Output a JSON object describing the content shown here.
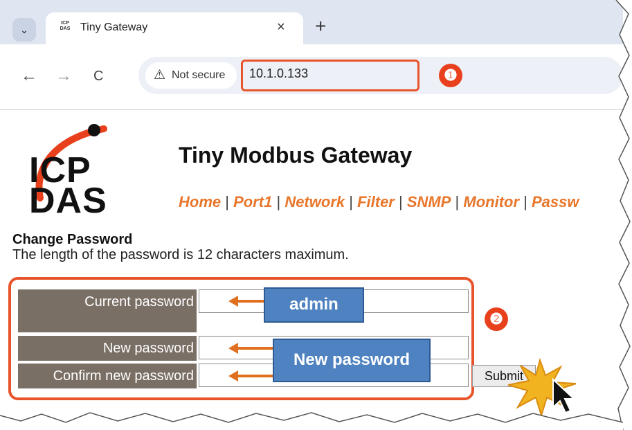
{
  "browser": {
    "tab_dropdown_icon": "chevron-down-icon",
    "tab_title": "Tiny Gateway",
    "tab_favicon_text": "ICP DAS",
    "tab_close": "×",
    "new_tab": "+",
    "back": "←",
    "forward": "→",
    "reload": "C",
    "security_warning_icon": "⚠",
    "security_label": "Not secure",
    "url": "10.1.0.133"
  },
  "annotations": {
    "step1": "❶",
    "step2": "❷",
    "callout_current": "admin",
    "callout_new": "New password"
  },
  "page": {
    "logo_line1": "ICP",
    "logo_line2": "DAS",
    "title": "Tiny Modbus Gateway",
    "nav_links": [
      "Home",
      "Port1",
      "Network",
      "Filter",
      "SNMP",
      "Monitor",
      "Passw"
    ],
    "nav_separator": "|",
    "heading": "Change Password",
    "description": "The length of the password is 12 characters maximum.",
    "form": {
      "current_label": "Current password",
      "new_label": "New password",
      "confirm_label": "Confirm new password",
      "submit_label": "Submit"
    }
  },
  "colors": {
    "accent_orange": "#e8762b",
    "highlight_red": "#e8542a",
    "label_bg": "#7a6f65",
    "callout_blue": "#4f82c0"
  }
}
